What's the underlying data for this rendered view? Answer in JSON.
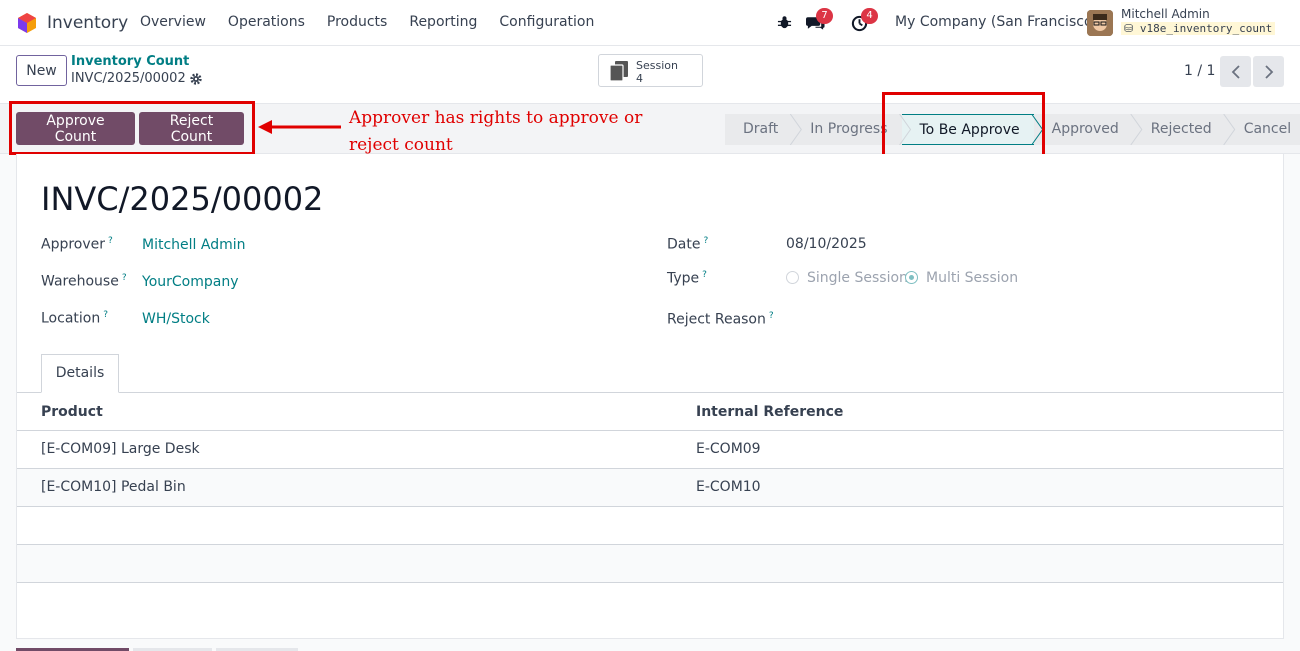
{
  "nav": {
    "app_name": "Inventory",
    "menu": [
      "Overview",
      "Operations",
      "Products",
      "Reporting",
      "Configuration"
    ],
    "messages_count": "7",
    "activities_count": "4",
    "company": "My Company (San Francisco)",
    "user_name": "Mitchell Admin",
    "db_name": "v18e_inventory_count"
  },
  "control": {
    "new_label": "New",
    "breadcrumb_parent": "Inventory Count",
    "breadcrumb_current": "INVC/2025/00002",
    "session_label": "Session",
    "session_value": "4",
    "pager": "1 / 1"
  },
  "actions": {
    "approve_label": "Approve Count",
    "reject_label": "Reject Count"
  },
  "stages": [
    {
      "label": "Draft",
      "active": false
    },
    {
      "label": "In Progress",
      "active": false
    },
    {
      "label": "To Be Approve",
      "active": true
    },
    {
      "label": "Approved",
      "active": false
    },
    {
      "label": "Rejected",
      "active": false
    },
    {
      "label": "Cancel",
      "active": false
    }
  ],
  "annotation": "Approver has rights to approve or reject count",
  "form": {
    "title": "INVC/2025/00002",
    "approver_label": "Approver",
    "approver_value": "Mitchell Admin",
    "warehouse_label": "Warehouse",
    "warehouse_value": "YourCompany",
    "location_label": "Location",
    "location_value": "WH/Stock",
    "date_label": "Date",
    "date_value": "08/10/2025",
    "type_label": "Type",
    "type_options": [
      "Single Session",
      "Multi Session"
    ],
    "type_selected": "Multi Session",
    "reject_reason_label": "Reject Reason",
    "help_mark": "?"
  },
  "tabs": [
    "Details"
  ],
  "table": {
    "columns": [
      "Product",
      "Internal Reference"
    ],
    "rows": [
      [
        "[E-COM09] Large Desk",
        "E-COM09"
      ],
      [
        "[E-COM10] Pedal Bin",
        "E-COM10"
      ]
    ]
  },
  "colors": {
    "brand": "#714b67",
    "link": "#017e84",
    "annotation": "#e00000"
  }
}
